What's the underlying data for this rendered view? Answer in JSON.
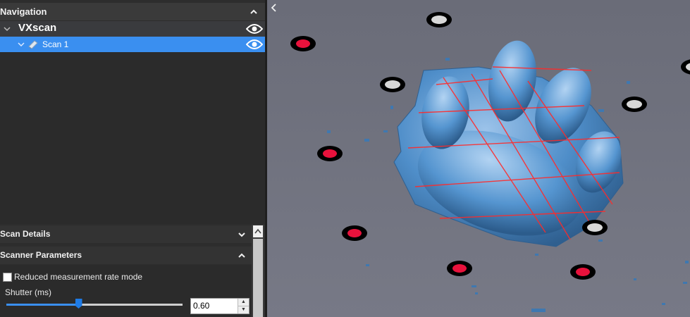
{
  "navigation": {
    "title": "Navigation",
    "root": {
      "label": "VXscan"
    },
    "scan": {
      "label": "Scan 1"
    }
  },
  "scan_details": {
    "title": "Scan Details"
  },
  "scanner_parameters": {
    "title": "Scanner Parameters",
    "reduced_mode": {
      "label": "Reduced measurement rate mode",
      "checked": false
    },
    "shutter": {
      "label": "Shutter (ms)",
      "value": "0.60",
      "slider_fraction": 0.41
    }
  },
  "colors": {
    "selected": "#3a8ff0",
    "panel": "#2d2d2d",
    "scan_mesh": "#4f8ec9",
    "laser_lines": "#ff2a2a",
    "target_red": "#e8123c",
    "target_white": "#d8d8d8"
  },
  "icons": {
    "collapse_nav": "chevron-up-icon",
    "visibility": "eye-icon",
    "scan": "scan-file-icon",
    "viewport_collapse": "chevron-left-icon"
  }
}
